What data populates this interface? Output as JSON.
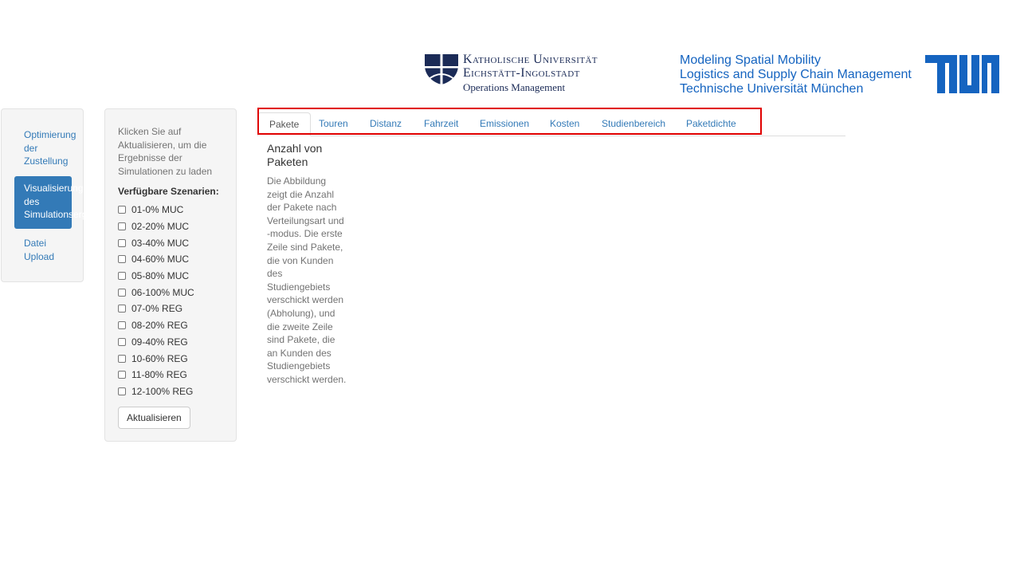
{
  "header": {
    "ku": {
      "line1": "Katholische Universität",
      "line2": "Eichstätt-Ingolstadt",
      "line3": "Operations Management"
    },
    "tum": {
      "lines": [
        "Modeling Spatial Mobility",
        "Logistics and Supply Chain Management",
        "Technische Universität München"
      ]
    }
  },
  "nav": {
    "items": [
      {
        "label": "Optimierung der Zustellung",
        "active": false
      },
      {
        "label": "Visualisierung des Simulationsergebnisse",
        "active": true
      },
      {
        "label": "Datei Upload",
        "active": false
      }
    ]
  },
  "scenarios": {
    "help_text": "Klicken Sie auf Aktualisieren, um die Ergebnisse der Simulationen zu laden",
    "label": "Verfügbare Szenarien:",
    "items": [
      "01-0% MUC",
      "02-20% MUC",
      "03-40% MUC",
      "04-60% MUC",
      "05-80% MUC",
      "06-100% MUC",
      "07-0% REG",
      "08-20% REG",
      "09-40% REG",
      "10-60% REG",
      "11-80% REG",
      "12-100% REG"
    ],
    "button_label": "Aktualisieren"
  },
  "tabs": [
    "Pakete",
    "Touren",
    "Distanz",
    "Fahrzeit",
    "Emissionen",
    "Kosten",
    "Studienbereich",
    "Paketdichte"
  ],
  "content": {
    "title": "Anzahl von Paketen",
    "description": "Die Abbildung zeigt die Anzahl der Pakete nach Verteilungsart und -modus. Die erste Zeile sind Pakete, die von Kunden des Studiengebiets verschickt werden (Abholung), und die zweite Zeile sind Pakete, die an Kunden des Studiengebiets verschickt werden."
  },
  "colors": {
    "link": "#337ab7",
    "tum_blue": "#1564c0",
    "ku_navy": "#1b2b57",
    "highlight": "#e00000"
  }
}
